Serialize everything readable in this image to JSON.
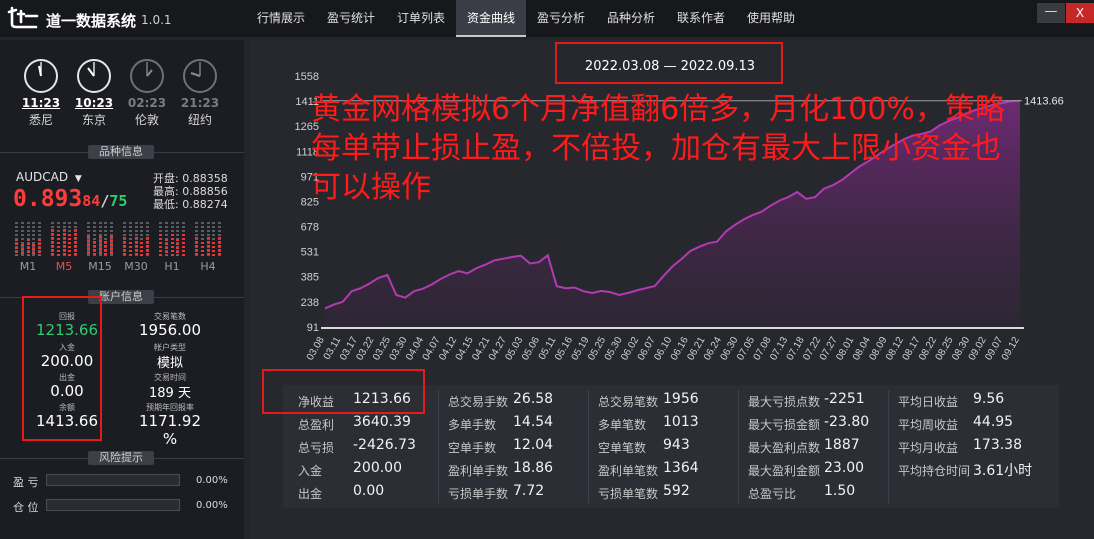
{
  "app": {
    "title": "道一数据系统",
    "version": "1.0.1",
    "logo": "道一"
  },
  "menu": [
    {
      "label": "行情展示",
      "active": false
    },
    {
      "label": "盈亏统计",
      "active": false
    },
    {
      "label": "订单列表",
      "active": false
    },
    {
      "label": "资金曲线",
      "active": true
    },
    {
      "label": "盈亏分析",
      "active": false
    },
    {
      "label": "品种分析",
      "active": false
    },
    {
      "label": "联系作者",
      "active": false
    },
    {
      "label": "使用帮助",
      "active": false
    }
  ],
  "window": {
    "minimize": "—",
    "close": "X"
  },
  "clocks": [
    {
      "time": "11:23",
      "city": "悉尼",
      "active": true
    },
    {
      "time": "10:23",
      "city": "东京",
      "active": true
    },
    {
      "time": "02:23",
      "city": "伦敦",
      "active": false
    },
    {
      "time": "21:23",
      "city": "纽约",
      "active": false
    }
  ],
  "symbol_info": {
    "header": "品种信息",
    "symbol": "AUDCAD",
    "price_main": "0.893",
    "price_bid_tail": "84",
    "price_ask_tail": "75",
    "open": "开盘: 0.88358",
    "high": "最高: 0.88856",
    "low": "最低: 0.88274",
    "timeframes": [
      {
        "label": "M1",
        "level": 0.45,
        "active": false
      },
      {
        "label": "M5",
        "level": 0.75,
        "active": true
      },
      {
        "label": "M15",
        "level": 0.55,
        "active": false
      },
      {
        "label": "M30",
        "level": 0.5,
        "active": false
      },
      {
        "label": "H1",
        "level": 0.6,
        "active": false
      },
      {
        "label": "H4",
        "level": 0.5,
        "active": false
      }
    ]
  },
  "account": {
    "header": "账户信息",
    "return_label": "回报",
    "return_value": "1213.66",
    "deposit_label": "入金",
    "deposit_value": "200.00",
    "withdraw_label": "出金",
    "withdraw_value": "0.00",
    "balance_label": "余额",
    "balance_value": "1413.66",
    "trades_label": "交易笔数",
    "trades_value": "1956.00",
    "type_label": "帐户类型",
    "type_value": "模拟",
    "time_label": "交易时间",
    "time_value": "189 天",
    "annual_label": "预期年回报率",
    "annual_value": "1171.92 %"
  },
  "risk": {
    "header": "风险提示",
    "rows": [
      {
        "label": "盈 亏",
        "value": "0.00%",
        "fill": 0
      },
      {
        "label": "仓 位",
        "value": "0.00%",
        "fill": 0
      }
    ]
  },
  "chart": {
    "date_range": "2022.03.08 — 2022.09.13",
    "overlay_text": "黄金网格模拟6个月净值翻6倍多，月化100%，策略每单带止损止盈，不倍投，加仓有最大上限小资金也可以操作",
    "end_label": "1413.66"
  },
  "chart_data": {
    "type": "area",
    "title": "",
    "yticks": [
      91,
      238,
      385,
      531,
      678,
      825,
      971,
      1118,
      1265,
      1411,
      1558
    ],
    "ylim": [
      91,
      1558
    ],
    "xticks": [
      "03.08",
      "03.11",
      "03.17",
      "03.22",
      "03.25",
      "03.30",
      "04.04",
      "04.07",
      "04.12",
      "04.15",
      "04.21",
      "04.27",
      "05.03",
      "05.06",
      "05.11",
      "05.16",
      "05.19",
      "05.25",
      "05.30",
      "06.02",
      "06.07",
      "06.10",
      "06.16",
      "06.21",
      "06.24",
      "06.30",
      "07.05",
      "07.08",
      "07.13",
      "07.18",
      "07.22",
      "07.27",
      "08.01",
      "08.04",
      "08.09",
      "08.12",
      "08.17",
      "08.22",
      "08.25",
      "08.30",
      "09.02",
      "09.07",
      "09.12"
    ],
    "end_value": 1413.66,
    "series": [
      {
        "values": [
          200,
          222,
          238,
          300,
          318,
          345,
          378,
          395,
          278,
          262,
          300,
          315,
          340,
          372,
          398,
          418,
          405,
          435,
          455,
          480,
          490,
          500,
          508,
          462,
          470,
          510,
          330,
          318,
          322,
          300,
          290,
          302,
          295,
          278,
          290,
          305,
          318,
          330,
          390,
          445,
          488,
          535,
          560,
          580,
          590,
          650,
          688,
          720,
          745,
          765,
          800,
          830,
          850,
          880,
          840,
          850,
          900,
          920,
          950,
          990,
          1030,
          1060,
          1095,
          1130,
          1160,
          1190,
          1210,
          1220,
          1235,
          1270,
          1295,
          1315,
          1340,
          1360,
          1375,
          1390,
          1400,
          1410,
          1413.66
        ]
      }
    ]
  },
  "stats": {
    "col1": [
      {
        "k": "净收益",
        "v": "1213.66"
      },
      {
        "k": "总盈利",
        "v": "3640.39"
      },
      {
        "k": "总亏损",
        "v": "-2426.73"
      },
      {
        "k": "入金",
        "v": "200.00"
      },
      {
        "k": "出金",
        "v": "0.00"
      }
    ],
    "col2": [
      {
        "k": "总交易手数",
        "v": "26.58"
      },
      {
        "k": "多单手数",
        "v": "14.54"
      },
      {
        "k": "空单手数",
        "v": "12.04"
      },
      {
        "k": "盈利单手数",
        "v": "18.86"
      },
      {
        "k": "亏损单手数",
        "v": "7.72"
      }
    ],
    "col3": [
      {
        "k": "总交易笔数",
        "v": "1956"
      },
      {
        "k": "多单笔数",
        "v": "1013"
      },
      {
        "k": "空单笔数",
        "v": "943"
      },
      {
        "k": "盈利单笔数",
        "v": "1364"
      },
      {
        "k": "亏损单笔数",
        "v": "592"
      }
    ],
    "col4": [
      {
        "k": "最大亏损点数",
        "v": "-2251"
      },
      {
        "k": "最大亏损金额",
        "v": "-23.80"
      },
      {
        "k": "最大盈利点数",
        "v": "1887"
      },
      {
        "k": "最大盈利金额",
        "v": "23.00"
      },
      {
        "k": "总盈亏比",
        "v": "1.50"
      }
    ],
    "col5": [
      {
        "k": "平均日收益",
        "v": "9.56"
      },
      {
        "k": "平均周收益",
        "v": "44.95"
      },
      {
        "k": "平均月收益",
        "v": "173.38"
      },
      {
        "k": "平均持仓时间",
        "v": "3.61小时"
      }
    ]
  },
  "colors": {
    "accent_red": "#ff1b1b",
    "line": "#b23ab2",
    "profit_green": "#2ecc71",
    "background": "#23252b"
  }
}
